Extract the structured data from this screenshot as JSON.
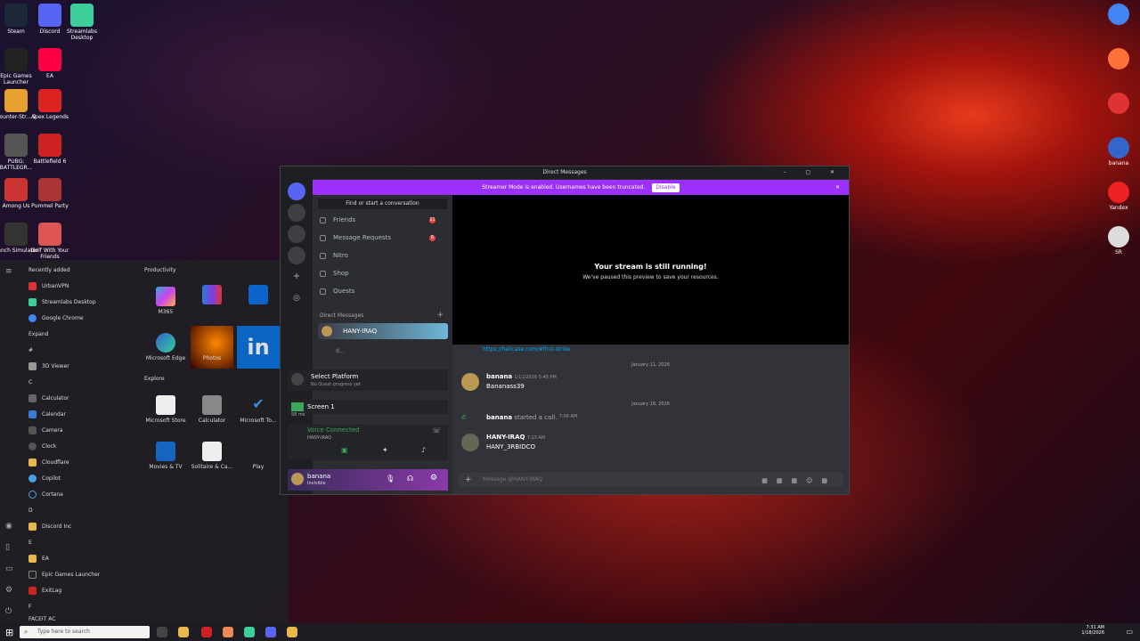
{
  "desktop": {
    "left_icons": [
      "Steam",
      "Discord",
      "Streamlabs Desktop",
      "Epic Games Launcher",
      "EA",
      "Counter-Str... 2",
      "Apex Legends",
      "PUBG: BATTLEGR...",
      "Battlefield 6",
      "Among Us",
      "Pummel Party",
      "Ranch Simulator",
      "Golf With Your Friends"
    ],
    "right_icons": [
      "",
      "",
      "",
      "banana",
      "Yandex",
      "SR"
    ]
  },
  "start_menu": {
    "recently_added": "Recently added",
    "recent": [
      "UrbanVPN",
      "Streamlabs Desktop",
      "Google Chrome"
    ],
    "expand": "Expand",
    "hash": "#",
    "a3d": "3D Viewer",
    "c": "C",
    "c_items": [
      "Calculator",
      "Calendar",
      "Camera",
      "Clock",
      "Cloudflare",
      "Copilot",
      "Cortana"
    ],
    "d": "D",
    "d_items": [
      "Discord Inc"
    ],
    "e": "E",
    "e_items": [
      "EA",
      "Epic Games Launcher",
      "ExitLag"
    ],
    "f": "F",
    "f_item": "FACEIT AC",
    "productivity": "Productivity",
    "explore": "Explore",
    "tiles": [
      "M365",
      "Microsoft Edge",
      "Photos",
      "",
      "Microsoft Store",
      "Calculator",
      "Microsoft To...",
      "Movies & TV",
      "Solitaire & Ca...",
      "Play"
    ]
  },
  "discord": {
    "title": "Direct Messages",
    "banner": "Streamer Mode is enabled. Usernames have been truncated.",
    "banner_btn": "Disable",
    "find": "Find or start a conversation",
    "nav": [
      "Friends",
      "Message Requests",
      "Nitro",
      "Shop",
      "Quests"
    ],
    "nav_badges": [
      "11",
      "6"
    ],
    "dm_header": "Direct Messages",
    "dm_user": "HANY-IRAQ",
    "dm_user2": "d...",
    "stream_title": "Your stream is still running!",
    "stream_sub": "We've paused this preview to save your resources.",
    "link": "https://helicase.com/#first-strike",
    "date1": "January 11, 2026",
    "date2": "January 18, 2026",
    "m1_name": "banana",
    "m1_time": "1/11/2026 5:45 PM",
    "m1_text": "Bananass39",
    "call_name": "banana",
    "call_text": "started a call.",
    "call_time": "7:06 AM",
    "m2_name": "HANY-IRAQ",
    "m2_time": "7:10 AM",
    "m2_text": "HANY_3RBIDCO",
    "platform": "Select Platform",
    "platform_sub": "No Quest progress yet",
    "screen": "Screen 1",
    "voice": "Voice Connected",
    "voice_sub": "HANY-IRAQ",
    "voice_ping": "58 ms",
    "user": "banana",
    "user_status": "Invisible",
    "composer": "Message @HANY-IRAQ"
  },
  "taskbar": {
    "search": "Type here to search",
    "time": "7:31 AM",
    "date": "1/18/2026"
  },
  "colors": {
    "accent": "#9b30ff",
    "discord_bg": "#313338"
  }
}
